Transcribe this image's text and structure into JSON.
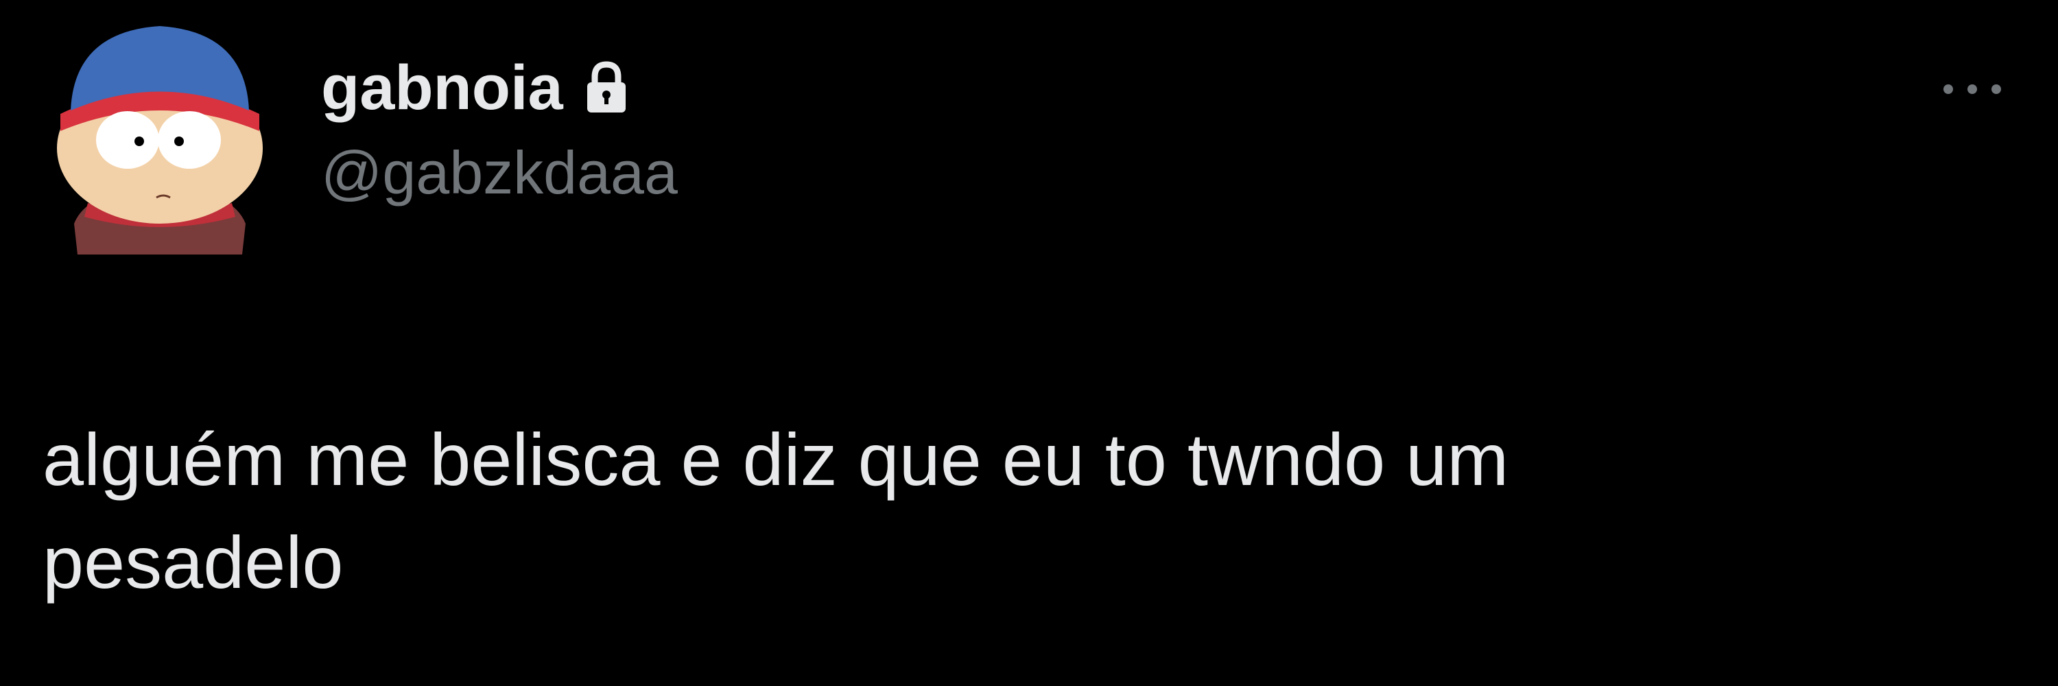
{
  "author": {
    "display_name": "gabnoia",
    "handle": "@gabzkdaaa",
    "avatar_icon": "stan-marsh-avatar",
    "lock_icon": "lock-icon"
  },
  "menu": {
    "icon": "more-options-icon"
  },
  "tweet": {
    "text": "alguém me belisca e diz que eu to twndo um\npesadelo"
  },
  "colors": {
    "background": "#000000",
    "primary_text": "#e7e9ea",
    "secondary_text": "#71767b"
  }
}
